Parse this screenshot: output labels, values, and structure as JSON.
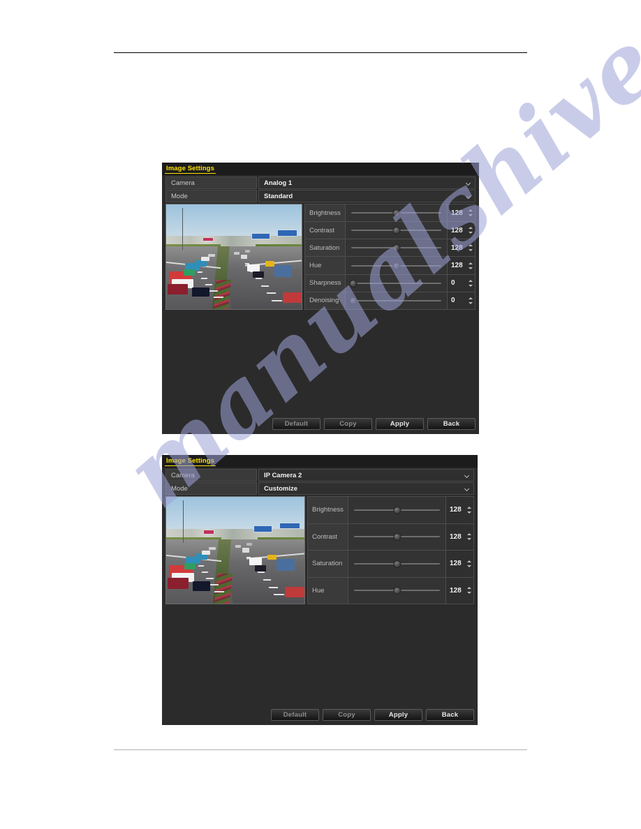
{
  "page": {
    "watermark": "manualshive.com",
    "header_rule": true,
    "footer_rule": true
  },
  "panels": [
    {
      "id": "analog",
      "title": "Image Settings",
      "fields": [
        {
          "label": "Camera",
          "value": "Analog 1",
          "icon": "chevron-down-icon"
        },
        {
          "label": "Mode",
          "value": "Standard",
          "icon": "chevron-down-icon"
        }
      ],
      "preview": {
        "alt": "live-camera-preview-highway"
      },
      "sliders": [
        {
          "name": "Brightness",
          "value": "128",
          "percent": 50
        },
        {
          "name": "Contrast",
          "value": "128",
          "percent": 50
        },
        {
          "name": "Saturation",
          "value": "128",
          "percent": 50
        },
        {
          "name": "Hue",
          "value": "128",
          "percent": 50
        },
        {
          "name": "Sharpness",
          "value": "0",
          "percent": 2
        },
        {
          "name": "Denoising",
          "value": "0",
          "percent": 2
        }
      ],
      "buttons": [
        {
          "label": "Default",
          "dim": true
        },
        {
          "label": "Copy",
          "dim": true
        },
        {
          "label": "Apply",
          "dim": false
        },
        {
          "label": "Back",
          "dim": false
        }
      ]
    },
    {
      "id": "ipcam",
      "title": "Image Settings",
      "fields": [
        {
          "label": "Camera",
          "value": "IP Camera 2",
          "icon": "chevron-down-icon"
        },
        {
          "label": "Mode",
          "value": "Customize",
          "icon": "chevron-down-icon"
        }
      ],
      "preview": {
        "alt": "live-camera-preview-highway"
      },
      "sliders": [
        {
          "name": "Brightness",
          "value": "128",
          "percent": 50
        },
        {
          "name": "Contrast",
          "value": "128",
          "percent": 50
        },
        {
          "name": "Saturation",
          "value": "128",
          "percent": 50
        },
        {
          "name": "Hue",
          "value": "128",
          "percent": 50
        }
      ],
      "buttons": [
        {
          "label": "Default",
          "dim": true
        },
        {
          "label": "Copy",
          "dim": true
        },
        {
          "label": "Apply",
          "dim": false
        },
        {
          "label": "Back",
          "dim": false
        }
      ]
    }
  ],
  "colors": {
    "panel_bg": "#2b2b2b",
    "title_yellow": "#ffe400",
    "watermark_blue": "#9ea3d8"
  }
}
